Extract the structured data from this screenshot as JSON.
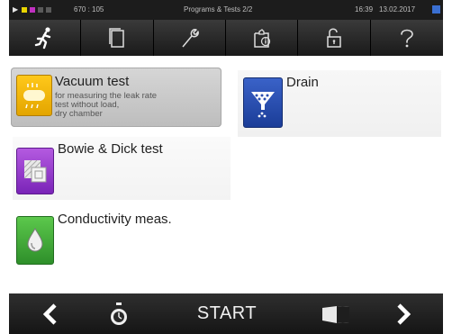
{
  "status": {
    "value": "670 : 105",
    "title": "Programs & Tests 2/2",
    "time": "16:39",
    "date": "13.02.2017"
  },
  "tabs": [
    {
      "icon": "runner-icon"
    },
    {
      "icon": "document-icon"
    },
    {
      "icon": "wrench-icon"
    },
    {
      "icon": "clipboard-info-icon"
    },
    {
      "icon": "padlock-icon"
    },
    {
      "icon": "help-icon"
    }
  ],
  "items": {
    "vacuum": {
      "title": "Vacuum test",
      "desc1": "for measuring the leak rate",
      "desc2": "test without load,",
      "desc3": "dry chamber"
    },
    "drain": {
      "title": "Drain"
    },
    "bowie": {
      "title": "Bowie & Dick test"
    },
    "conductivity": {
      "title": "Conductivity meas."
    }
  },
  "bottom": {
    "start_label": "START"
  },
  "colors": {
    "vacuum_icon": "#f2b400",
    "drain_icon": "#2a4fb0",
    "bowie_icon": "#8e36c8",
    "conductivity_icon": "#3aa83a"
  }
}
